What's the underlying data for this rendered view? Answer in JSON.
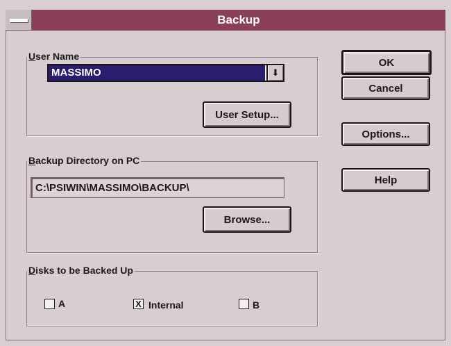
{
  "window": {
    "title": "Backup"
  },
  "user_group": {
    "legend": "User Name",
    "legend_underline": "U",
    "legend_rest": "ser Name",
    "selected_user": "MASSIMO",
    "arrow_glyph": "⬇",
    "setup_button": "User Setup..."
  },
  "dir_group": {
    "legend_underline": "B",
    "legend_rest": "ackup Directory on PC",
    "path": "C:\\PSIWIN\\MASSIMO\\BACKUP\\",
    "browse_button": "Browse..."
  },
  "disks_group": {
    "legend_underline": "D",
    "legend_rest": "isks to be Backed Up",
    "options": [
      {
        "label": "A",
        "checked": false,
        "mark": ""
      },
      {
        "label": "Internal",
        "checked": true,
        "mark": "X"
      },
      {
        "label": "B",
        "checked": false,
        "mark": ""
      }
    ]
  },
  "buttons": {
    "ok": "OK",
    "cancel": "Cancel",
    "options": "Options...",
    "help": "Help"
  },
  "colors": {
    "titlebar": "#8a3f58",
    "selection": "#2a1d6d",
    "face": "#d8cdd1"
  }
}
